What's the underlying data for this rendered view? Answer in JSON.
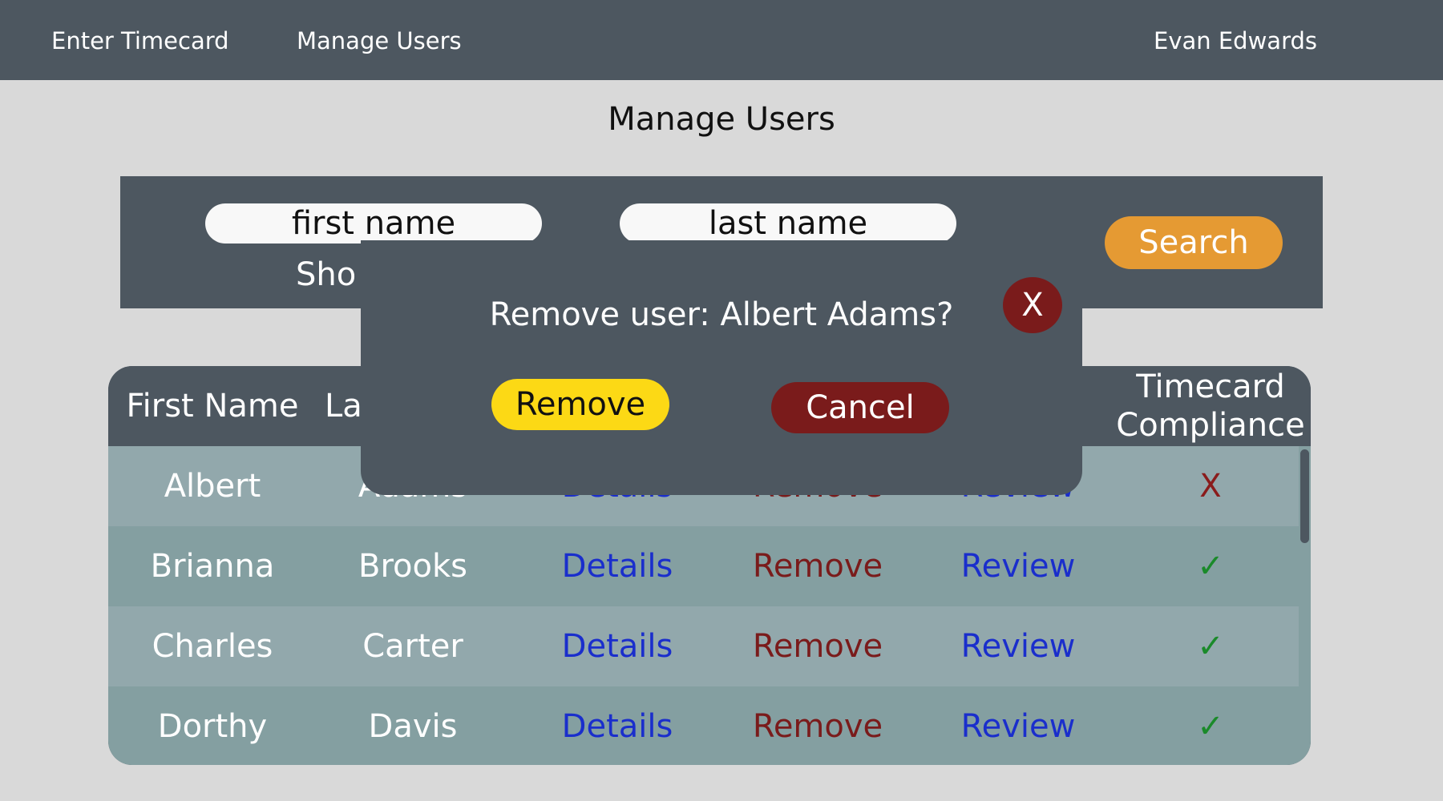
{
  "nav": {
    "items": [
      {
        "label": "Enter Timecard"
      },
      {
        "label": "Manage Users"
      }
    ],
    "user": "Evan Edwards"
  },
  "page": {
    "title": "Manage Users"
  },
  "search": {
    "first_placeholder": "first name",
    "last_placeholder": "last name",
    "button_label": "Search",
    "show_label": "Sho"
  },
  "table": {
    "headers": {
      "first": "First Name",
      "last": "La",
      "compliance_line1": "Timecard",
      "compliance_line2": "Compliance"
    },
    "rows": [
      {
        "first": "Albert",
        "last": "Adams",
        "details": "Details",
        "remove": "Remove",
        "review": "Review",
        "compliance": "X"
      },
      {
        "first": "Brianna",
        "last": "Brooks",
        "details": "Details",
        "remove": "Remove",
        "review": "Review",
        "compliance": "✓"
      },
      {
        "first": "Charles",
        "last": "Carter",
        "details": "Details",
        "remove": "Remove",
        "review": "Review",
        "compliance": "✓"
      },
      {
        "first": "Dorthy",
        "last": "Davis",
        "details": "Details",
        "remove": "Remove",
        "review": "Review",
        "compliance": "✓"
      }
    ]
  },
  "modal": {
    "message": "Remove user: Albert Adams?",
    "close_label": "X",
    "remove_label": "Remove",
    "cancel_label": "Cancel"
  },
  "colors": {
    "nav_bg": "#4d5760",
    "page_bg": "#d9d9d9",
    "search_button": "#e59a33",
    "remove_button": "#fcd915",
    "cancel_button": "#7a1b1b",
    "link_blue": "#1a2ecc",
    "remove_red": "#7a1b1b",
    "check_green": "#1a8a2a"
  }
}
